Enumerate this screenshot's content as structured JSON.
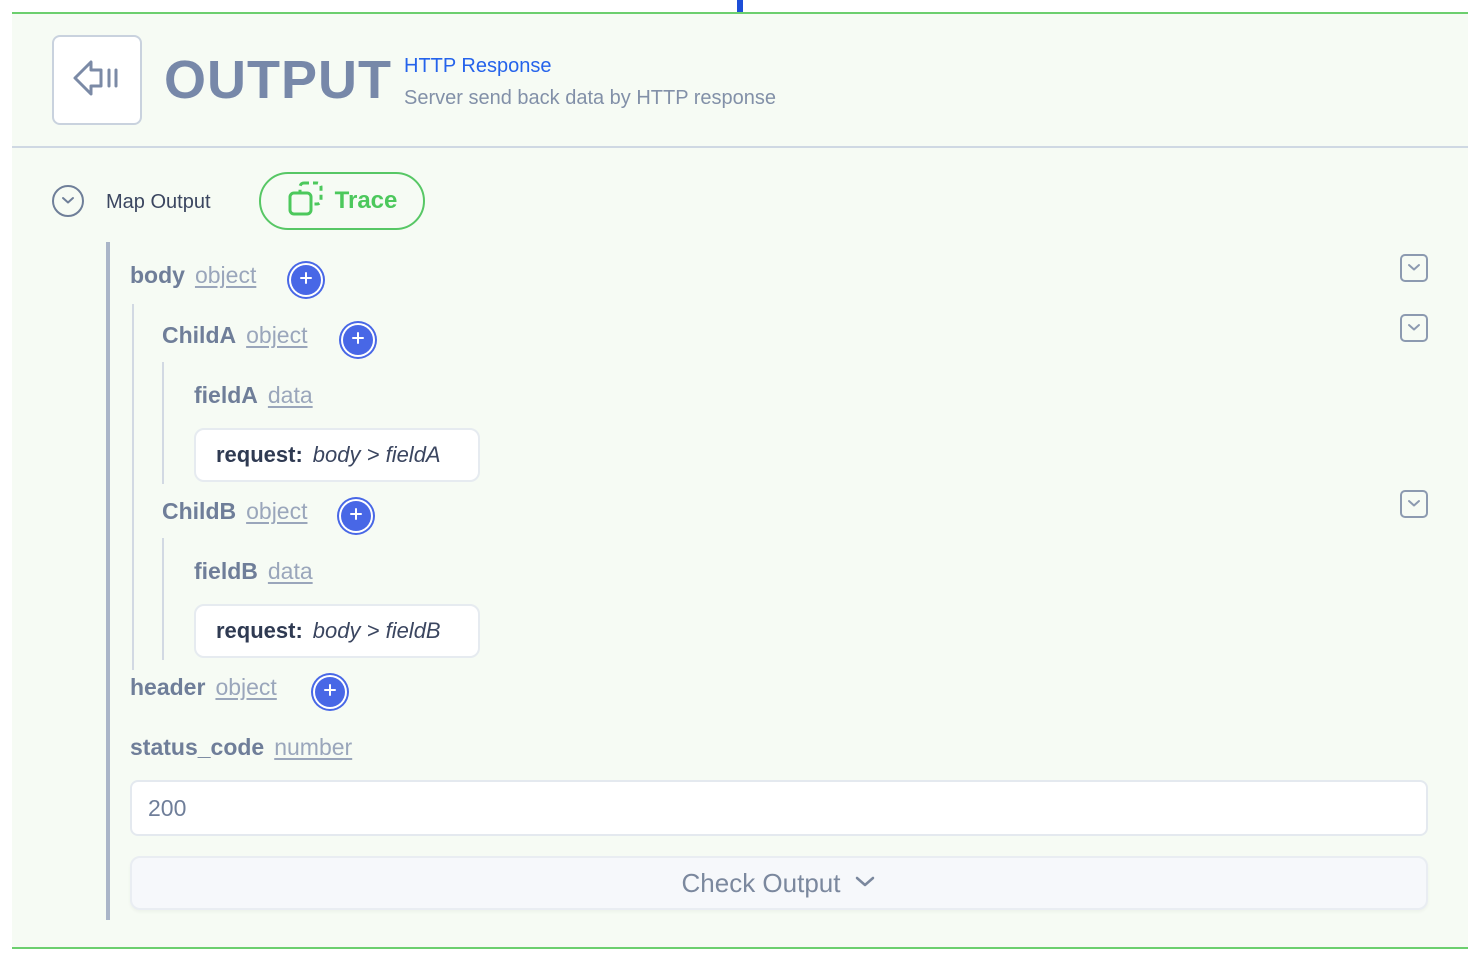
{
  "header": {
    "title": "OUTPUT",
    "subtitle": "HTTP Response",
    "description": "Server send back data by HTTP response",
    "icon": "exit-arrow-icon"
  },
  "map_output": {
    "label": "Map Output",
    "trace_label": "Trace"
  },
  "tree": {
    "body": {
      "name": "body",
      "type": "object"
    },
    "childA": {
      "name": "ChildA",
      "type": "object"
    },
    "fieldA": {
      "name": "fieldA",
      "type": "data",
      "mapping_key": "request:",
      "mapping_value": "body > fieldA"
    },
    "childB": {
      "name": "ChildB",
      "type": "object"
    },
    "fieldB": {
      "name": "fieldB",
      "type": "data",
      "mapping_key": "request:",
      "mapping_value": "body > fieldB"
    },
    "header": {
      "name": "header",
      "type": "object"
    },
    "status_code": {
      "name": "status_code",
      "type": "number",
      "value": "200"
    }
  },
  "check_output": {
    "label": "Check Output"
  },
  "colors": {
    "accent_blue": "#4867e6",
    "trace_green": "#4cc85c",
    "panel_border": "#6ccf6e"
  }
}
